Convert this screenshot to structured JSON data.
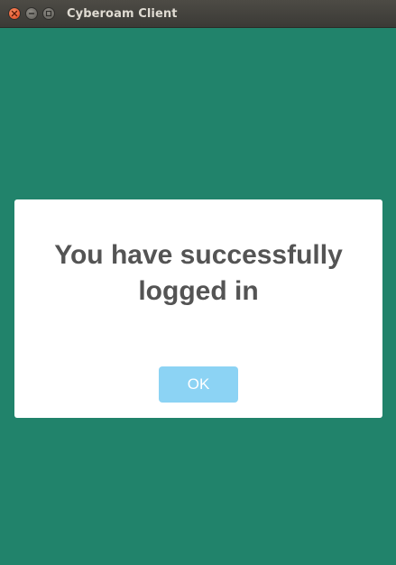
{
  "window": {
    "title": "Cyberoam Client",
    "controls": {
      "close_icon": "close-icon",
      "minimize_icon": "minimize-icon",
      "maximize_icon": "maximize-icon"
    }
  },
  "dialog": {
    "message": "You have successfully logged in",
    "ok_label": "OK"
  },
  "colors": {
    "background": "#21836b",
    "dialog": "#ffffff",
    "message_text": "#545454",
    "ok_button": "#8cd3f4",
    "ok_text": "#ffffff"
  }
}
